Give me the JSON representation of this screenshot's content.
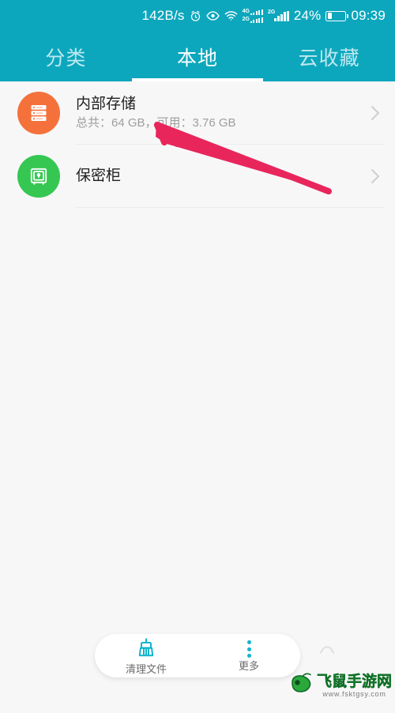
{
  "status_bar": {
    "network_speed": "142B/s",
    "icons": [
      "alarm-clock-icon",
      "eye-icon",
      "wifi-icon",
      "dual-sim-4g-2g-icon",
      "signal-2g-icon"
    ],
    "sim1_label_top": "4G",
    "sim1_label_bottom": "2G",
    "sim2_label": "2G",
    "battery_percent": "24%",
    "battery_level": 24,
    "clock": "09:39",
    "background_color": "#0ca7bd",
    "text_color": "#ffffff"
  },
  "tabs": {
    "active_index": 1,
    "items": [
      {
        "label": "分类",
        "name": "tab-categories"
      },
      {
        "label": "本地",
        "name": "tab-local"
      },
      {
        "label": "云收藏",
        "name": "tab-cloud-favorites"
      }
    ],
    "indicator_color": "#ffffff",
    "inactive_color": "#bfe8ef"
  },
  "storage_list": [
    {
      "icon": "server-storage-icon",
      "icon_color": "#f4713c",
      "title": "内部存储",
      "subtitle": "总共：64 GB，可用：3.76 GB",
      "total": "64 GB",
      "available": "3.76 GB"
    },
    {
      "icon": "safe-lock-icon",
      "icon_color": "#35c752",
      "title": "保密柜",
      "subtitle": ""
    }
  ],
  "annotation": {
    "type": "arrow",
    "color": "#e8265c",
    "points_to": "内部存储 容量信息"
  },
  "bottom_bar": {
    "items": [
      {
        "label": "清理文件",
        "icon": "broom-clean-icon",
        "name": "clean-files-button"
      },
      {
        "label": "更多",
        "icon": "more-vertical-dots-icon",
        "name": "more-button"
      }
    ],
    "accent_color": "#0fb4cc"
  },
  "watermark": {
    "site_name": "飞鼠手游网",
    "url": "www.fsktgsy.com",
    "logo": "green-mouse-icon",
    "color": "#1f9c3a"
  }
}
